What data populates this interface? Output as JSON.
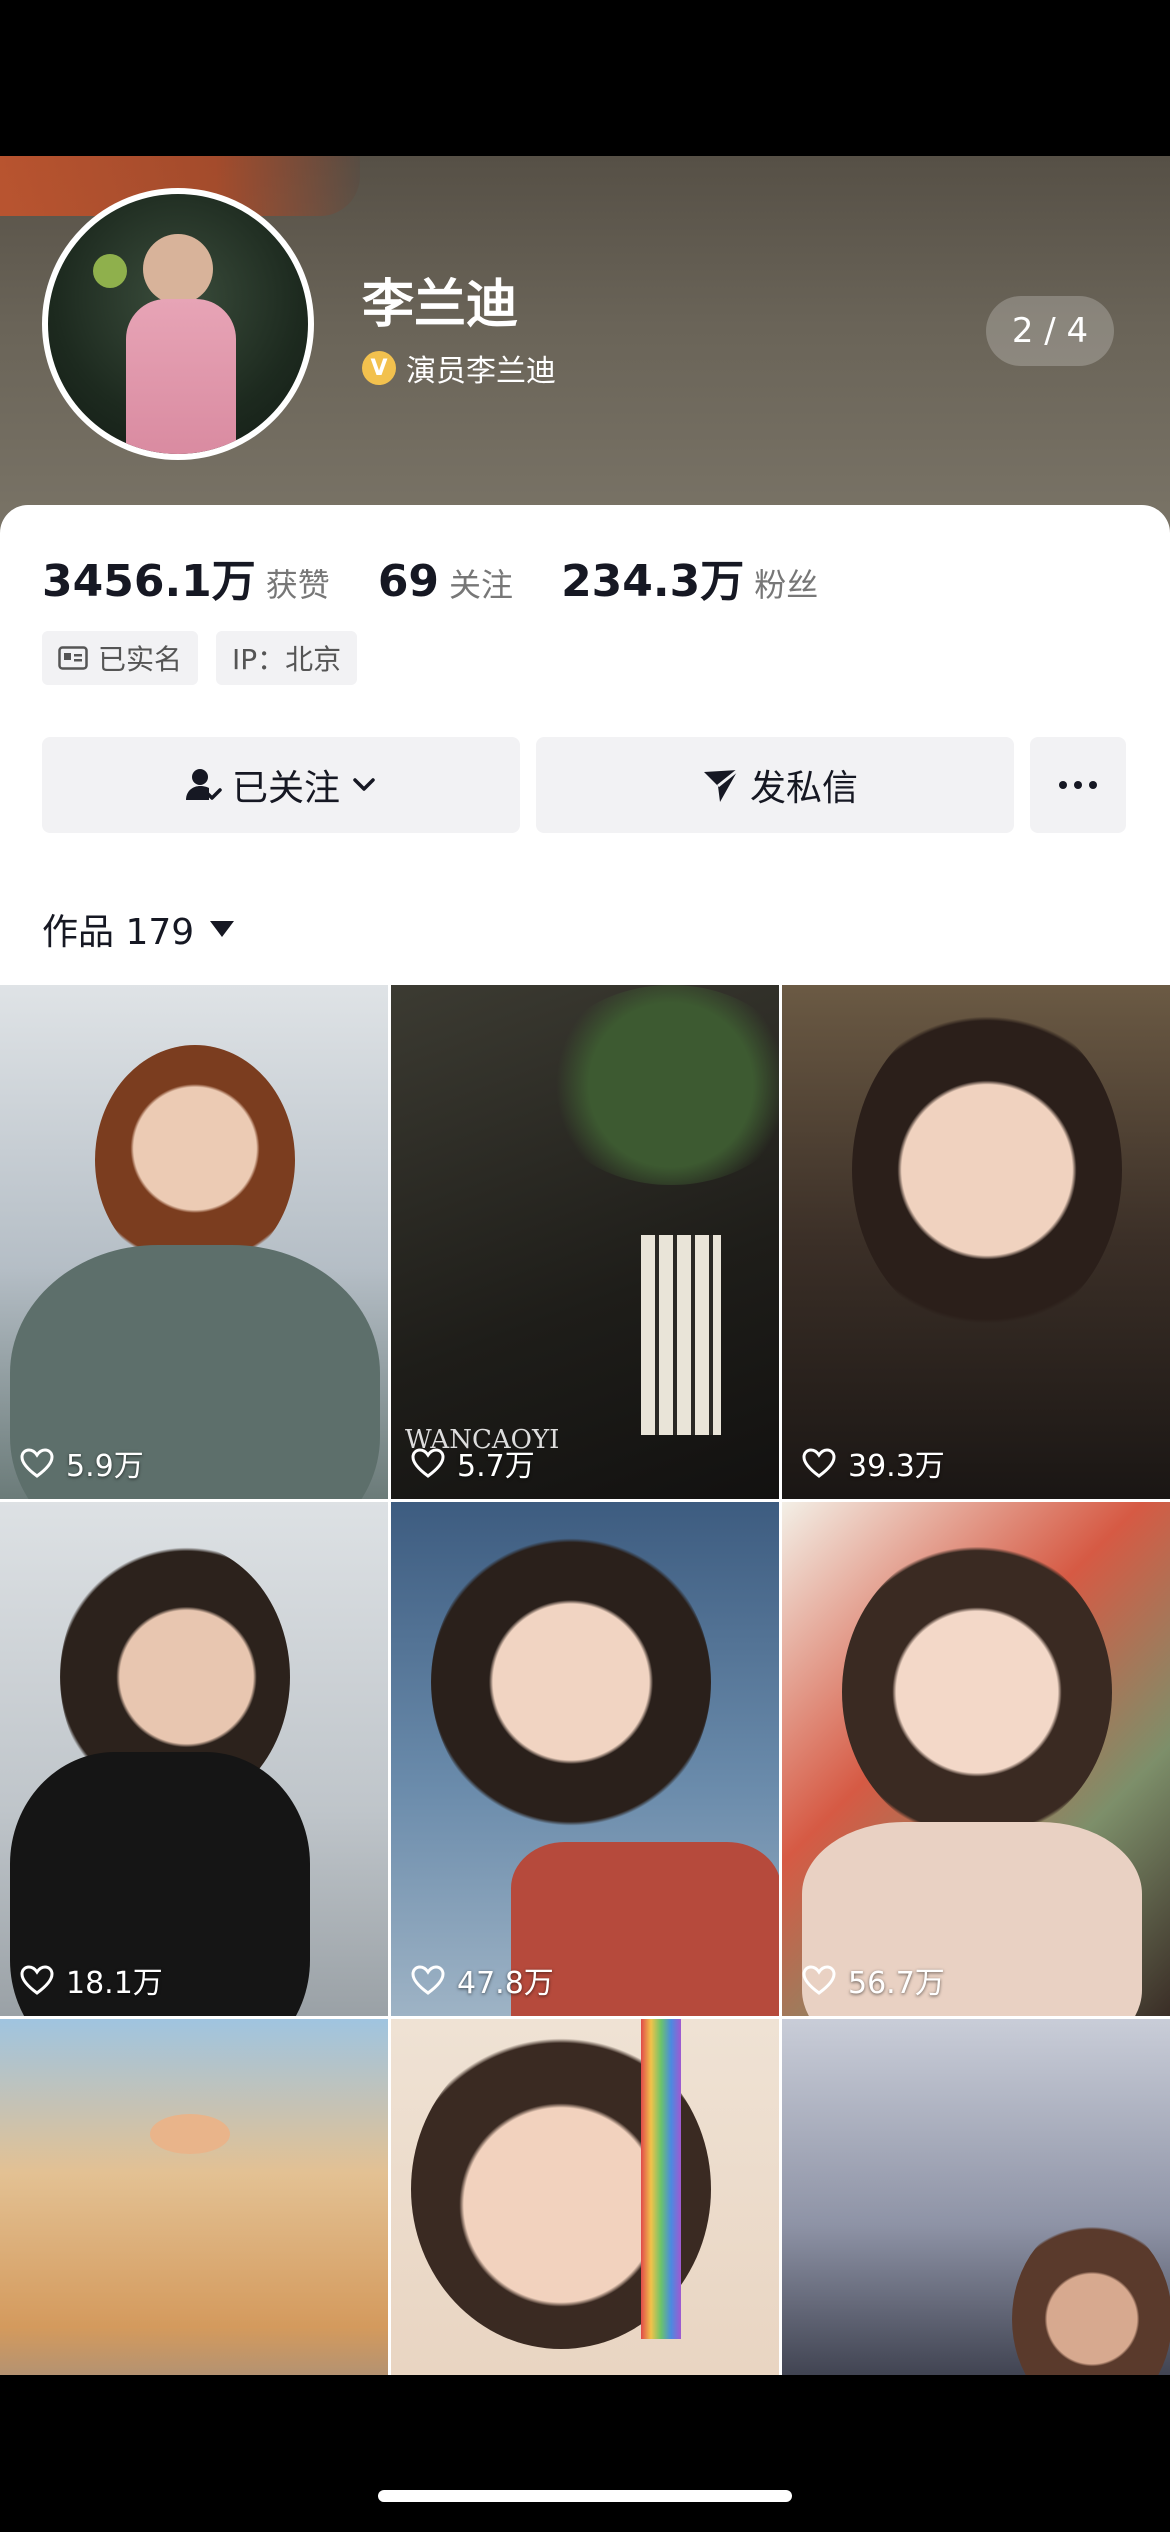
{
  "profile": {
    "name": "李兰迪",
    "verify_badge": "V",
    "verified_title": "演员李兰迪",
    "pager": "2 / 4"
  },
  "stats": [
    {
      "value": "3456.1万",
      "label": "获赞"
    },
    {
      "value": "69",
      "label": "关注"
    },
    {
      "value": "234.3万",
      "label": "粉丝"
    }
  ],
  "tags": {
    "real_name": "已实名",
    "ip": "IP：北京"
  },
  "actions": {
    "follow_label": "已关注",
    "message_label": "发私信",
    "more_icon": "more-icon"
  },
  "works": {
    "label": "作品 179"
  },
  "grid": [
    {
      "likes": "5.9万",
      "bg": "#c9d1d6"
    },
    {
      "likes": "5.7万",
      "bg": "#2b2a24",
      "overlay_text": "WANCAOYI"
    },
    {
      "likes": "39.3万",
      "bg": "#4a3a30"
    },
    {
      "likes": "18.1万",
      "bg": "#b9bec3"
    },
    {
      "likes": "47.8万",
      "bg": "#5a7ca0"
    },
    {
      "likes": "56.7万",
      "bg": "#b9473a"
    },
    {
      "likes": "",
      "bg": "#d69b5f"
    },
    {
      "likes": "",
      "bg": "#e6d4c3"
    },
    {
      "likes": "",
      "bg": "#9ea4b5"
    }
  ],
  "colors": {
    "accent_verify": "#f2c14e",
    "button_bg": "#f2f2f4",
    "text_primary": "#161823",
    "text_secondary": "#777777"
  }
}
